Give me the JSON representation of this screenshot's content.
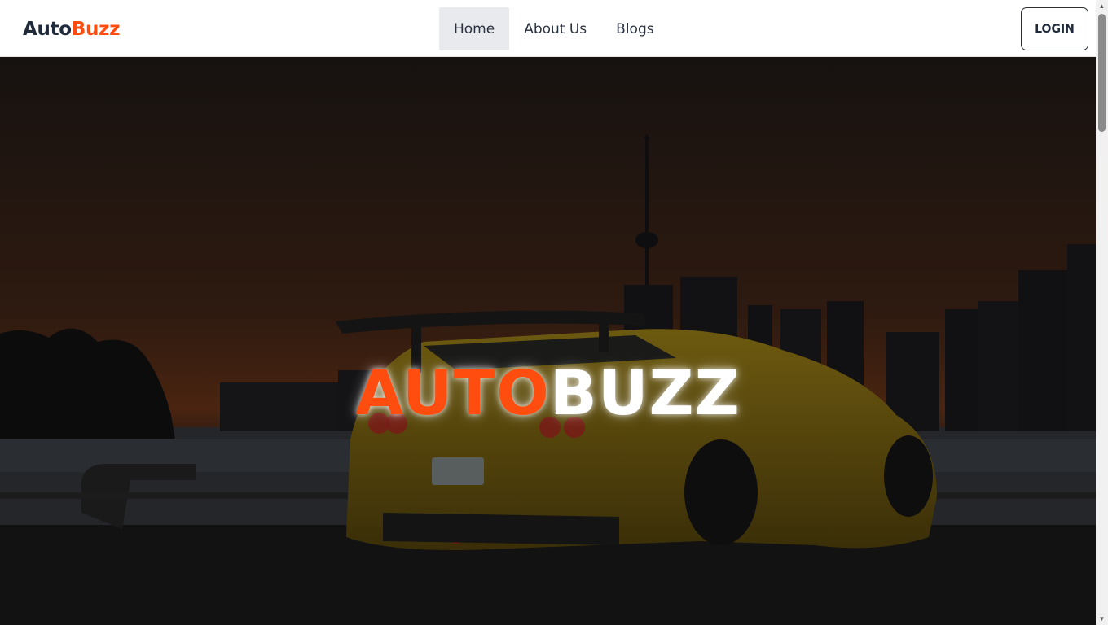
{
  "brand": {
    "part1": "Auto",
    "part2": "Buzz"
  },
  "nav": {
    "items": [
      {
        "label": "Home",
        "active": true
      },
      {
        "label": "About Us",
        "active": false
      },
      {
        "label": "Blogs",
        "active": false
      }
    ]
  },
  "login": {
    "label": "LOGIN"
  },
  "hero": {
    "title_part1": "AUTO",
    "title_part2": "BUZZ"
  },
  "colors": {
    "accent": "#ff4c0f",
    "dark_text": "#1f2a3a"
  },
  "icons": {
    "scroll_up": "triangle-up-icon",
    "scroll_down": "triangle-down-icon"
  }
}
